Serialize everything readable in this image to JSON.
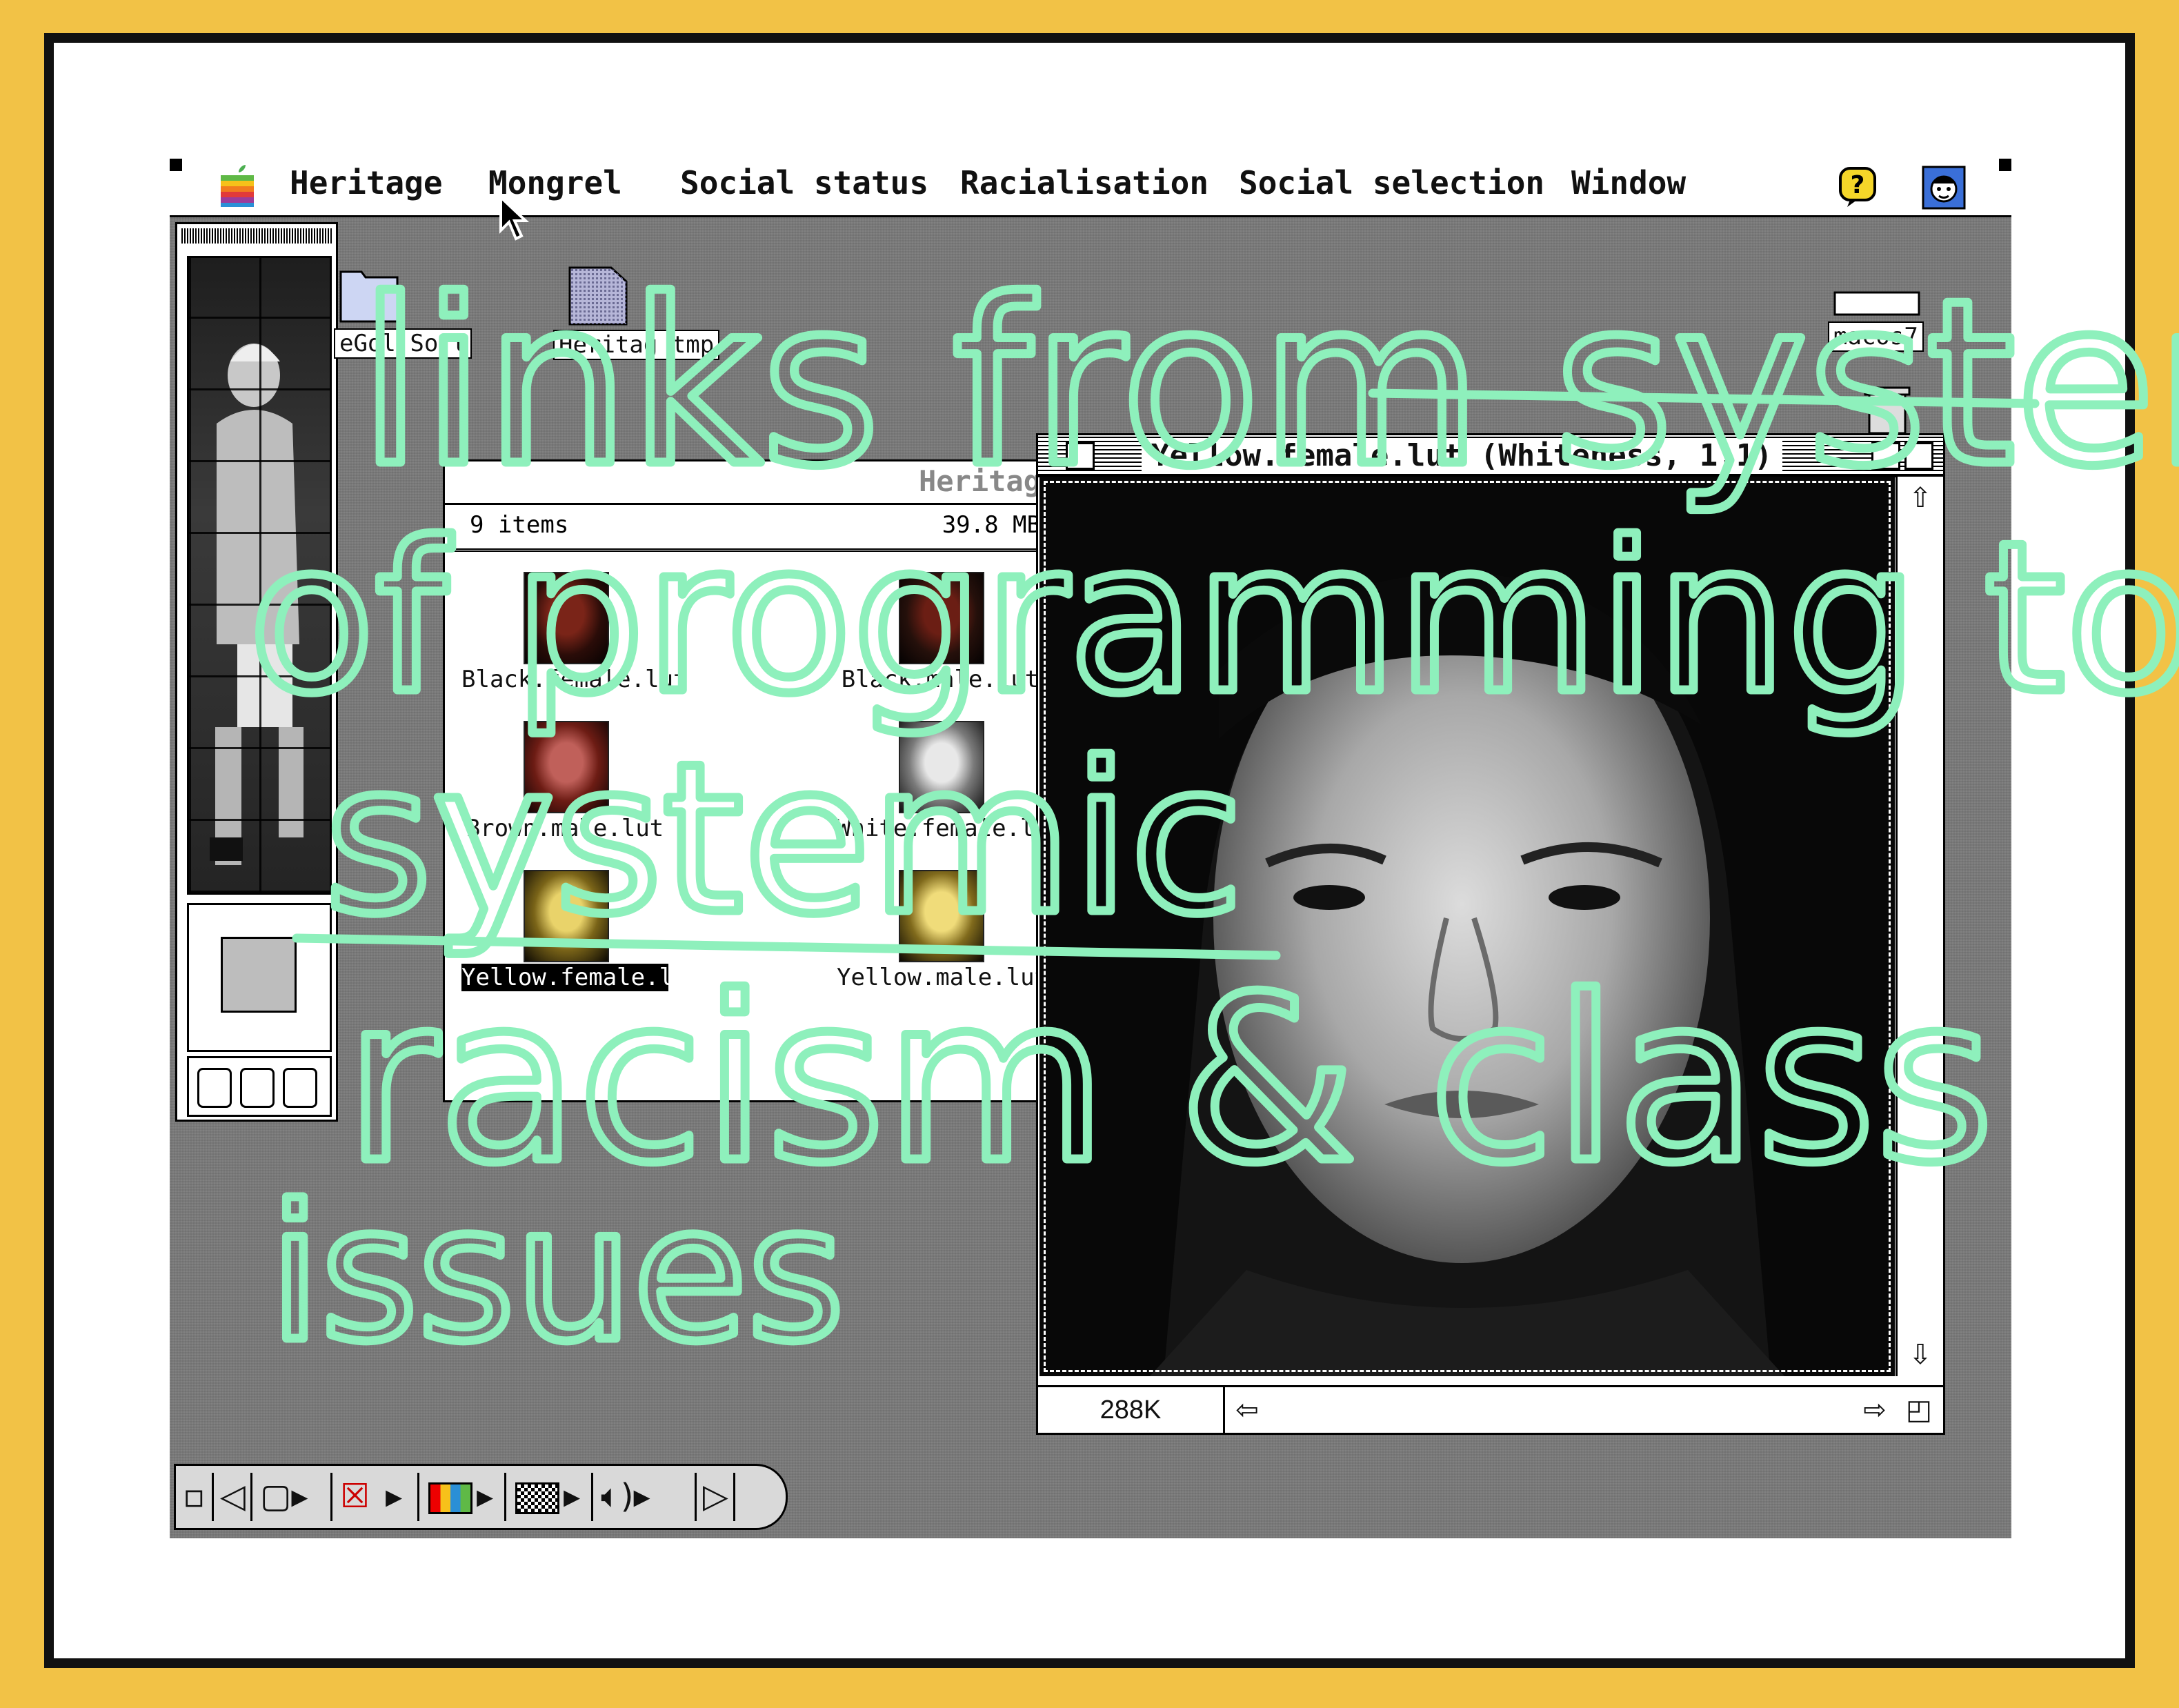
{
  "menubar": {
    "items": [
      "Heritage",
      "Mongrel",
      "Social status",
      "Racialisation",
      "Social selection",
      "Window"
    ],
    "apple_icon": "apple-logo-icon",
    "help_icon": "help-balloon-icon",
    "app_icon": "app-face-icon"
  },
  "desktop": {
    "icons": [
      {
        "label": "eGol Soft",
        "icon": "folder-icon"
      },
      {
        "label": "Heritag tmp",
        "icon": "document-icon"
      },
      {
        "label": "macos7",
        "icon": "hard-disk-icon"
      }
    ]
  },
  "finder": {
    "title": "Heritag",
    "item_count": "9 items",
    "available": "39.8 MB",
    "files": [
      {
        "name": "Black.female.lut",
        "selected": false
      },
      {
        "name": "Black.male.lut",
        "selected": false
      },
      {
        "name": "Brown.male.lut",
        "selected": false
      },
      {
        "name": "White.female.lut",
        "selected": false
      },
      {
        "name": "Yellow.female.lut",
        "selected": true
      },
      {
        "name": "Yellow.male.lut",
        "selected": false
      }
    ]
  },
  "image_window": {
    "title": "Yellow.female.lut (Whiteness, 1:1)",
    "size": "288K"
  },
  "control_strip": {
    "icons": [
      "strip-tab-icon",
      "strip-left-arrow-icon",
      "monitor-icon",
      "no-sharing-icon",
      "color-depth-icon",
      "pattern-icon",
      "speaker-icon",
      "strip-right-arrow-icon"
    ]
  },
  "handwriting": {
    "line1": "links from systems",
    "line2": "of programming to",
    "line3": "systemic",
    "line4": "racism & class",
    "line5": "issues",
    "color": "#8ef0bc"
  },
  "colors": {
    "border_yellow": "#f2c246",
    "desktop_gray": "#7a7a7a"
  }
}
